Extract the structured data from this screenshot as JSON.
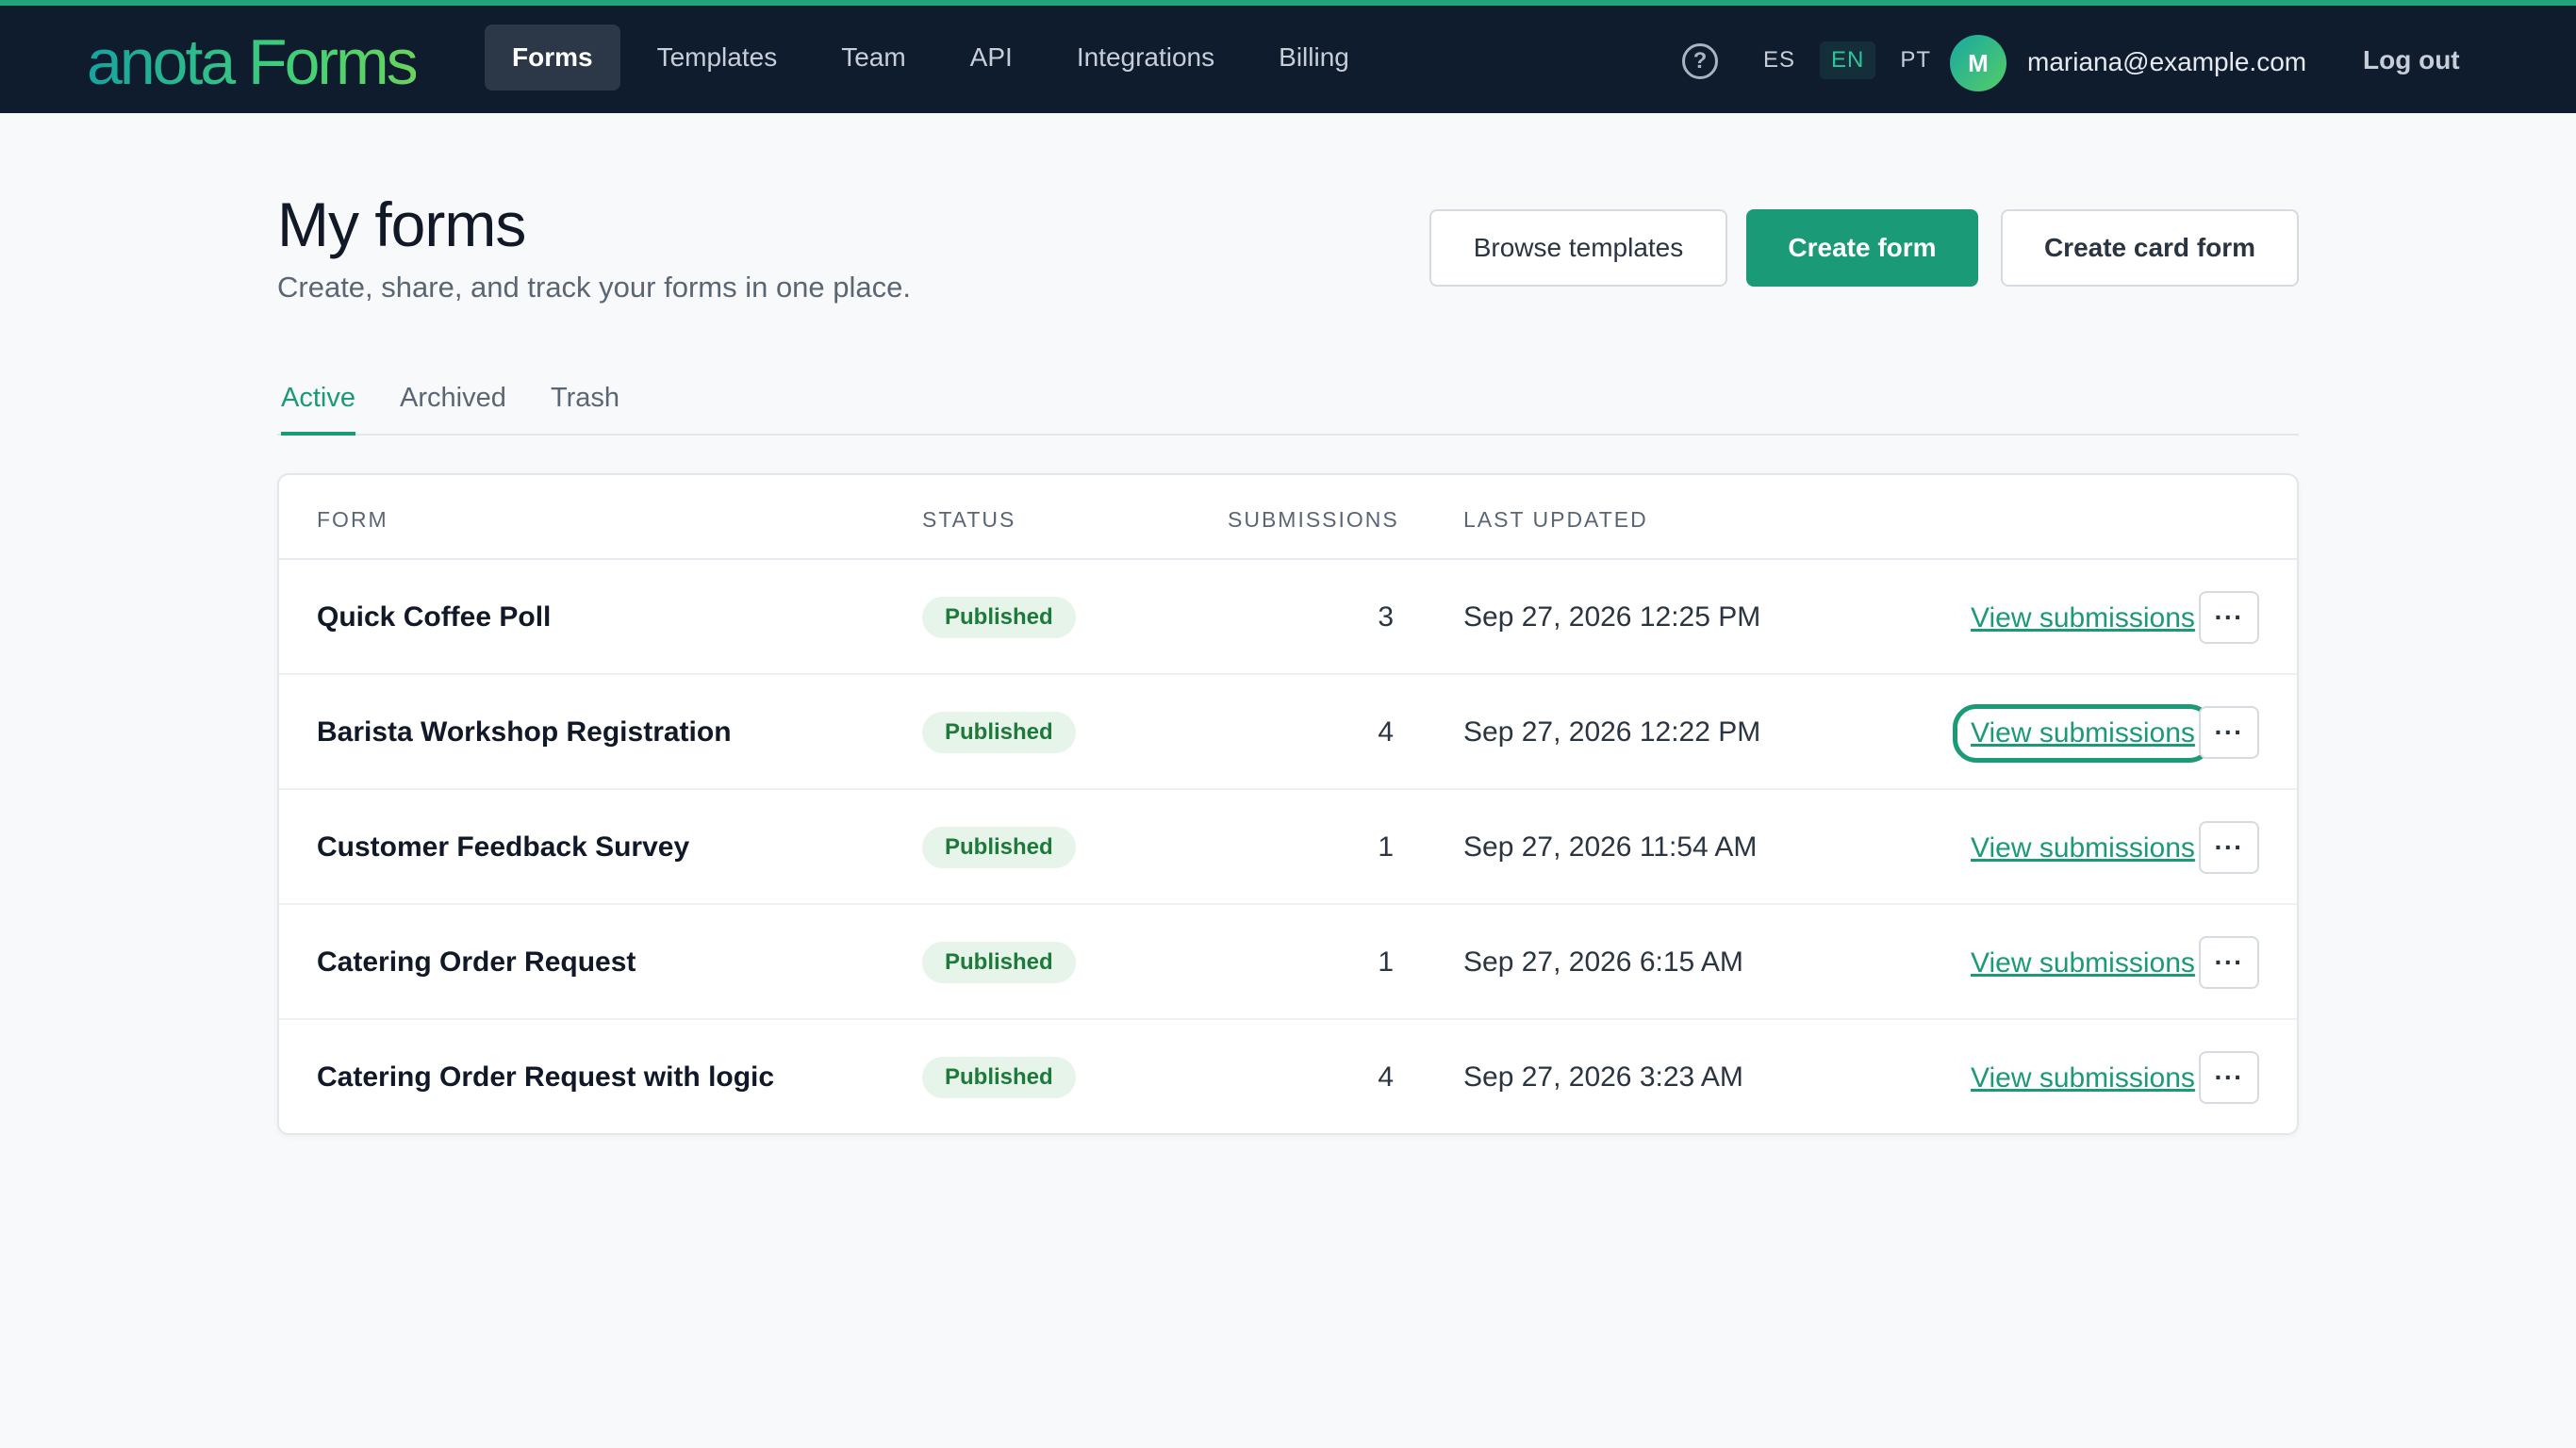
{
  "app": {
    "logo": "anota Forms",
    "nav": [
      "Forms",
      "Templates",
      "Team",
      "API",
      "Integrations",
      "Billing"
    ],
    "active_nav": "Forms",
    "help_glyph": "?",
    "languages": [
      "ES",
      "EN",
      "PT"
    ],
    "active_language": "EN",
    "user": {
      "initial": "M",
      "email": "mariana@example.com"
    },
    "logout_label": "Log out"
  },
  "header": {
    "title": "My forms",
    "subtitle": "Create, share, and track your forms in one place.",
    "browse_label": "Browse templates",
    "create_label": "Create form",
    "create_card_label": "Create card form"
  },
  "tabs": [
    "Active",
    "Archived",
    "Trash"
  ],
  "active_tab": "Active",
  "table": {
    "columns": [
      "FORM",
      "STATUS",
      "SUBMISSIONS",
      "LAST UPDATED"
    ],
    "view_label": "View submissions",
    "more_glyph": "···",
    "rows": [
      {
        "name": "Quick Coffee Poll",
        "status": "Published",
        "submissions": "3",
        "updated": "Sep 27, 2026 12:25 PM"
      },
      {
        "name": "Barista Workshop Registration",
        "status": "Published",
        "submissions": "4",
        "updated": "Sep 27, 2026 12:22 PM",
        "focused": true
      },
      {
        "name": "Customer Feedback Survey",
        "status": "Published",
        "submissions": "1",
        "updated": "Sep 27, 2026 11:54 AM"
      },
      {
        "name": "Catering Order Request",
        "status": "Published",
        "submissions": "1",
        "updated": "Sep 27, 2026 6:15 AM"
      },
      {
        "name": "Catering Order Request with logic",
        "status": "Published",
        "submissions": "4",
        "updated": "Sep 27, 2026 3:23 AM"
      }
    ]
  },
  "colors": {
    "accent": "#1b9a78",
    "topbar": "#0f1c2e",
    "badge_bg": "#e6f4ea",
    "badge_text": "#1e7a3a"
  }
}
